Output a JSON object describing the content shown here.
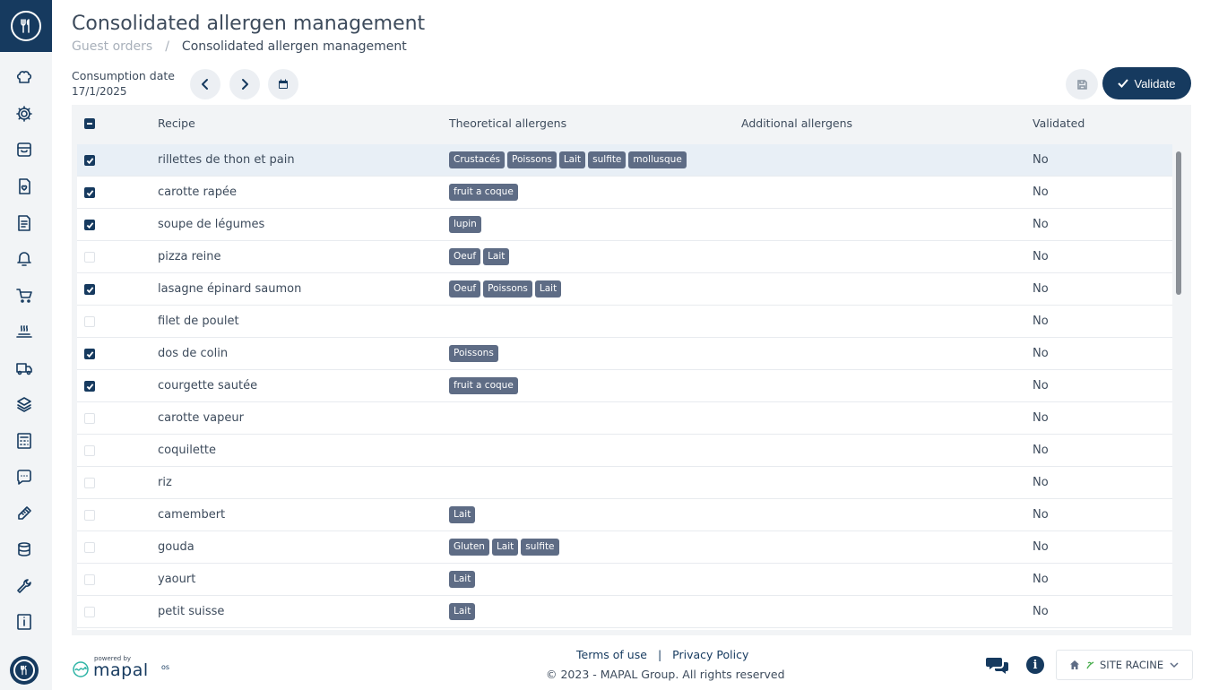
{
  "header": {
    "title": "Consolidated allergen management",
    "breadcrumb": [
      "Guest orders",
      "Consolidated allergen management"
    ],
    "breadcrumb_separator": "/"
  },
  "date": {
    "label": "Consumption date",
    "value": "17/1/2025"
  },
  "toolbar": {
    "validate_label": "Validate"
  },
  "table": {
    "columns": [
      "Recipe",
      "Theoretical allergens",
      "Additional allergens",
      "Validated"
    ],
    "rows": [
      {
        "recipe": "rillettes de thon et pain",
        "allergens": [
          "Crustacés",
          "Poissons",
          "Lait",
          "sulfite",
          "mollusque"
        ],
        "validated": "No",
        "checked": true
      },
      {
        "recipe": "carotte rapée",
        "allergens": [
          "fruit a coque"
        ],
        "validated": "No",
        "checked": true
      },
      {
        "recipe": "soupe de légumes",
        "allergens": [
          "lupin"
        ],
        "validated": "No",
        "checked": true
      },
      {
        "recipe": "pizza reine",
        "allergens": [
          "Oeuf",
          "Lait"
        ],
        "validated": "No",
        "checked": false
      },
      {
        "recipe": "lasagne épinard saumon",
        "allergens": [
          "Oeuf",
          "Poissons",
          "Lait"
        ],
        "validated": "No",
        "checked": true
      },
      {
        "recipe": "filet de poulet",
        "allergens": [],
        "validated": "No",
        "checked": false
      },
      {
        "recipe": "dos de colin",
        "allergens": [
          "Poissons"
        ],
        "validated": "No",
        "checked": true
      },
      {
        "recipe": "courgette sautée",
        "allergens": [
          "fruit a coque"
        ],
        "validated": "No",
        "checked": true
      },
      {
        "recipe": "carotte vapeur",
        "allergens": [],
        "validated": "No",
        "checked": false
      },
      {
        "recipe": "coquilette",
        "allergens": [],
        "validated": "No",
        "checked": false
      },
      {
        "recipe": "riz",
        "allergens": [],
        "validated": "No",
        "checked": false
      },
      {
        "recipe": "camembert",
        "allergens": [
          "Lait"
        ],
        "validated": "No",
        "checked": false
      },
      {
        "recipe": "gouda",
        "allergens": [
          "Gluten",
          "Lait",
          "sulfite"
        ],
        "validated": "No",
        "checked": false
      },
      {
        "recipe": "yaourt",
        "allergens": [
          "Lait"
        ],
        "validated": "No",
        "checked": false
      },
      {
        "recipe": "petit suisse",
        "allergens": [
          "Lait"
        ],
        "validated": "No",
        "checked": false
      }
    ]
  },
  "footer": {
    "powered_by": "powered by",
    "brand": "mapal",
    "brand_suffix": "os",
    "terms": "Terms of use",
    "privacy": "Privacy Policy",
    "link_separator": "|",
    "copyright": "© 2023 - MAPAL Group. All rights reserved",
    "site": "SITE RACINE"
  },
  "colors": {
    "primary": "#163a5f",
    "tag_bg": "#5e6c85",
    "table_bg": "#f2f4f6",
    "highlight_row": "#e8eff6"
  },
  "sidebar_icons": [
    "chef-hat-icon",
    "gear-icon",
    "inbox-icon",
    "heart-document-icon",
    "document-list-icon",
    "bell-icon",
    "cart-icon",
    "serving-dish-icon",
    "delivery-truck-icon",
    "layers-icon",
    "calculator-icon",
    "chat-bubble-icon",
    "thermometer-icon",
    "database-icon",
    "wrench-icon",
    "info-box-icon"
  ]
}
